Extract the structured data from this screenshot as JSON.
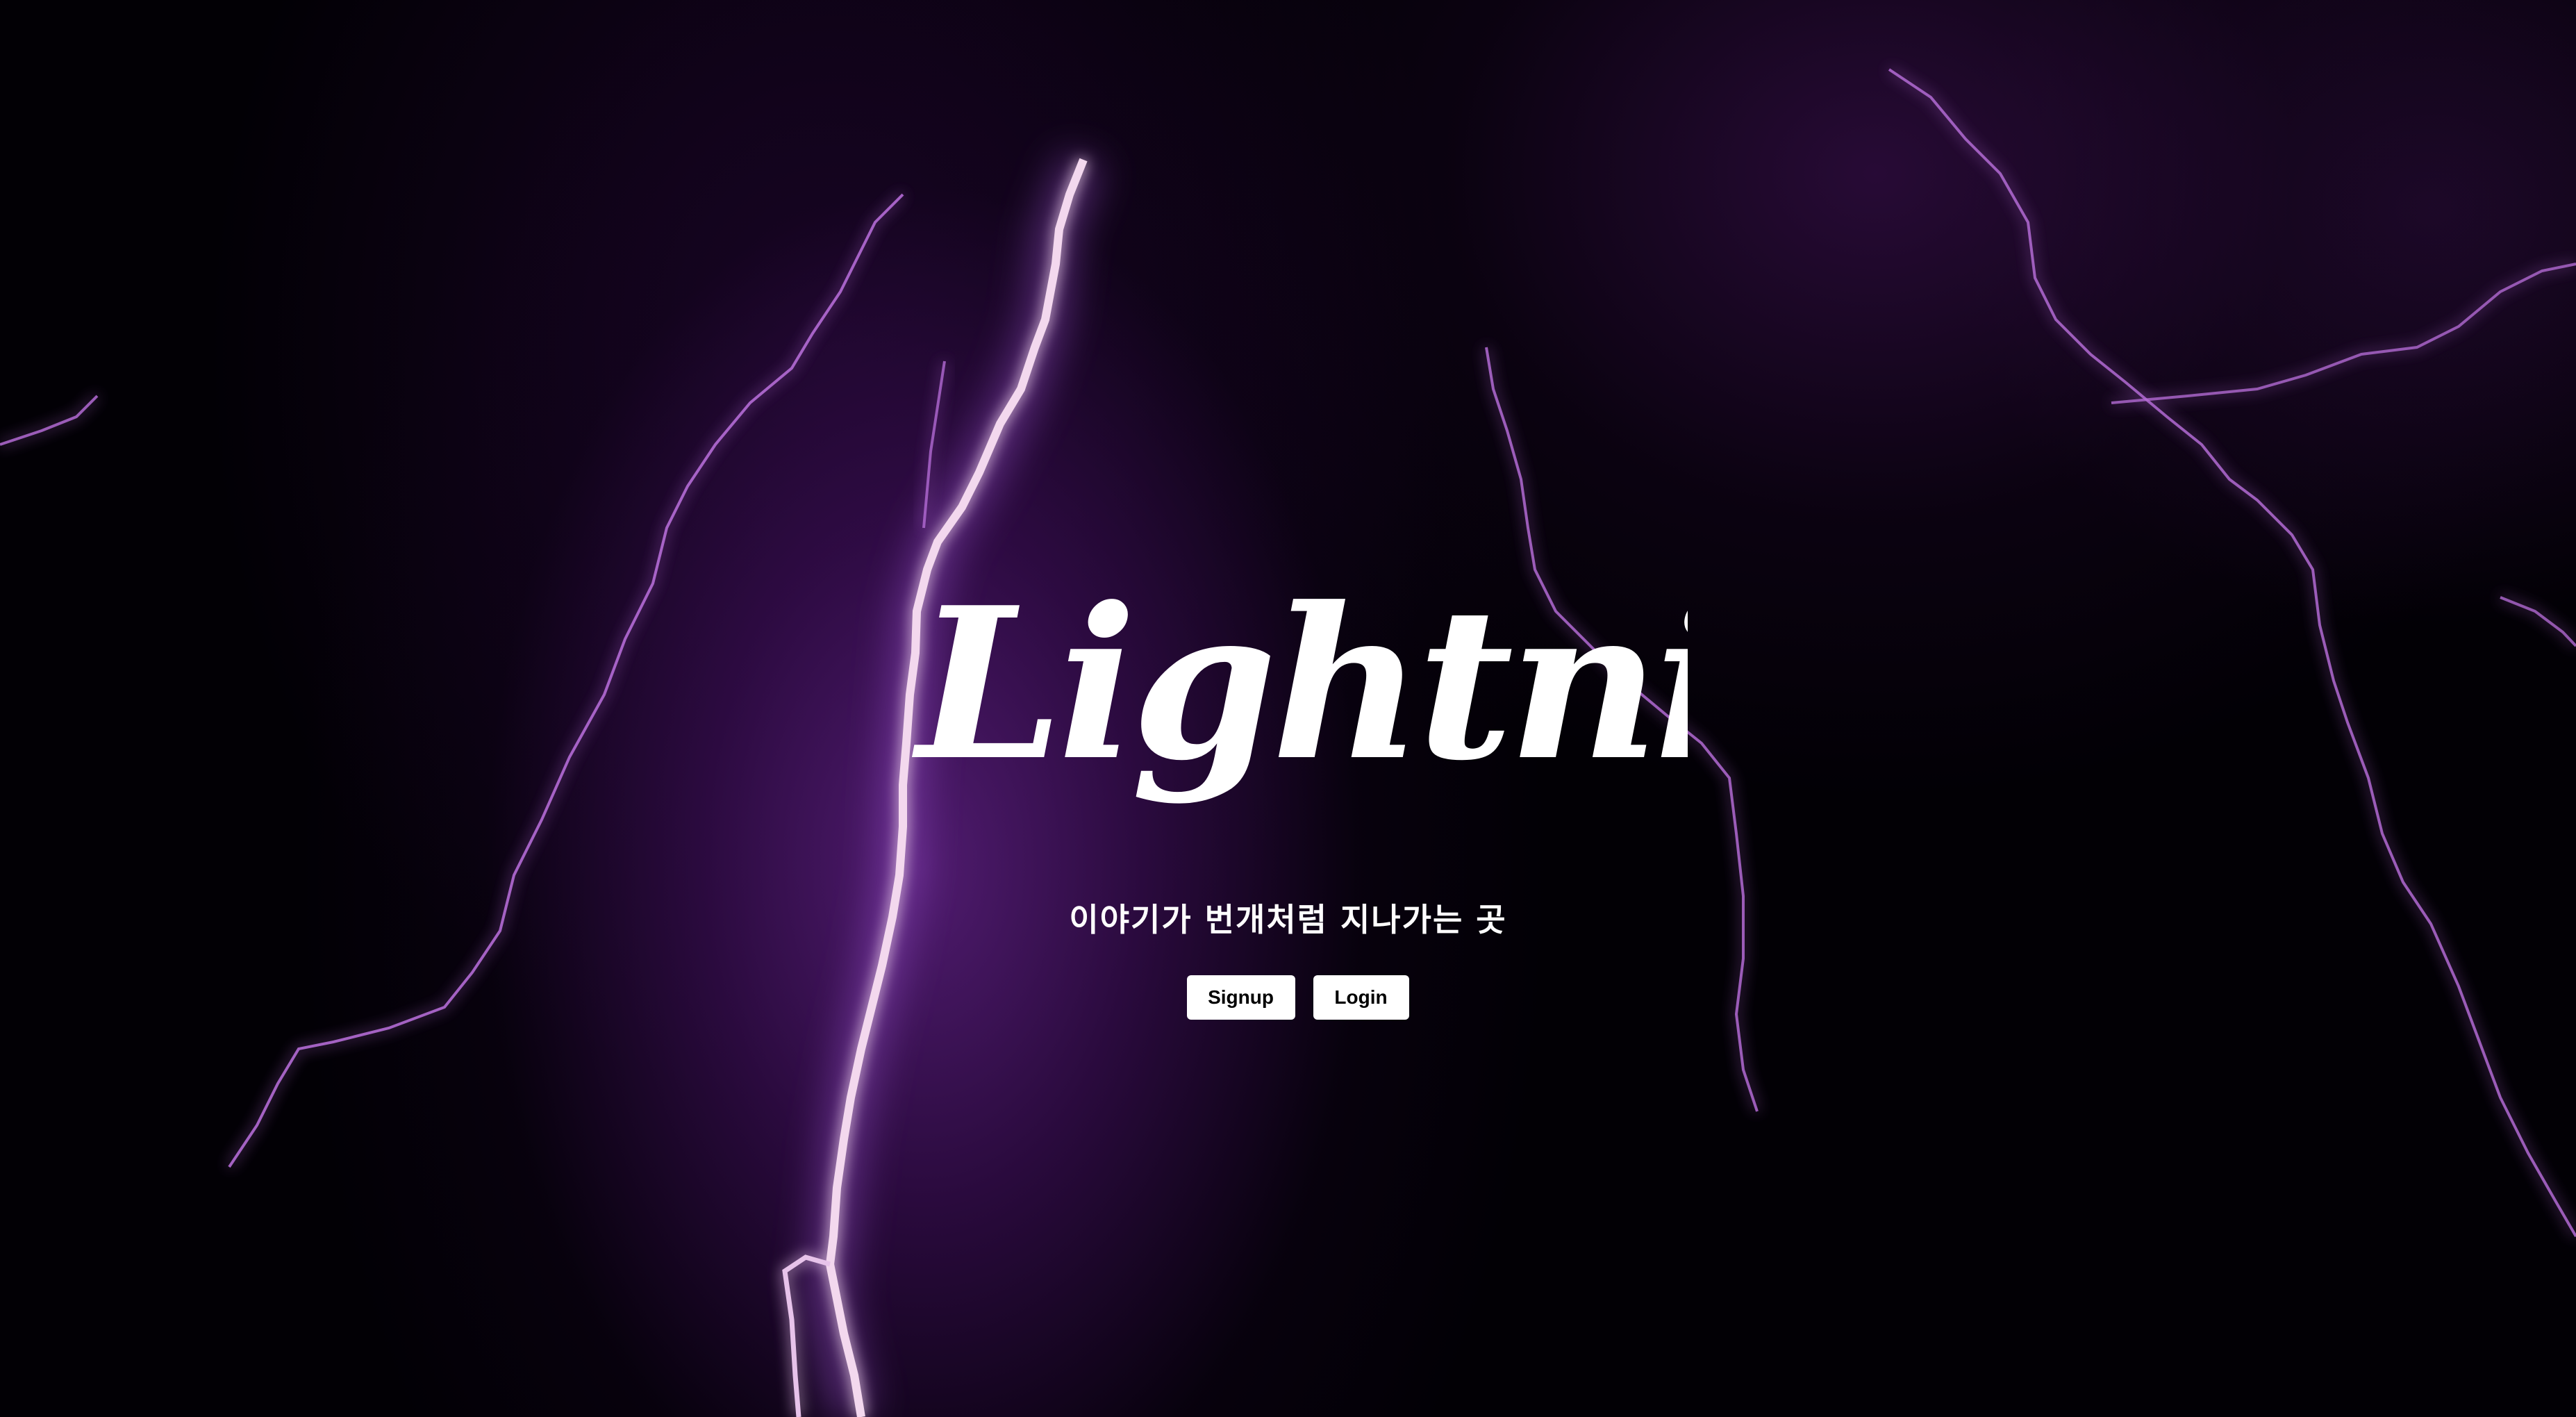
{
  "hero": {
    "logo_text": "Lightning",
    "tagline": "이야기가 번개처럼 지나가는 곳"
  },
  "actions": {
    "signup_label": "Signup",
    "login_label": "Login"
  },
  "colors": {
    "background": "#020005",
    "glow": "#5c2080",
    "bolt_core": "#f3d8ee",
    "bolt_edge": "#b66dd8",
    "text": "#ffffff",
    "button_bg": "#ffffff",
    "button_text": "#000000"
  }
}
